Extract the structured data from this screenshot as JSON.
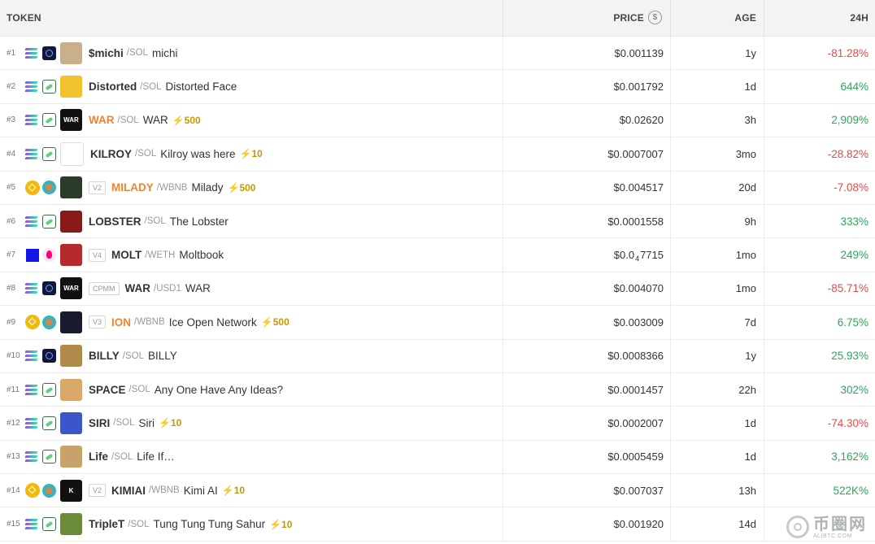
{
  "header": {
    "token": "TOKEN",
    "price": "PRICE",
    "price_icon": "dollar-circle-icon",
    "age": "AGE",
    "change": "24H"
  },
  "colors": {
    "positive": "#2ea55b",
    "negative": "#e04b4b",
    "hot_symbol": "#f0842c",
    "boost": "#c79700"
  },
  "rows": [
    {
      "rank": "#1",
      "chain": "sol",
      "dex": "launch",
      "avatar_color": "#c8b08a",
      "avatar_text": "",
      "version": "",
      "symbol": "$michi",
      "hot": false,
      "quote": "/SOL",
      "name": "michi",
      "boost": "",
      "price": "$0.001139",
      "price_main": "",
      "price_sub": "",
      "price_tail": "",
      "age": "1y",
      "change": "-81.28%",
      "change_sign": "neg"
    },
    {
      "rank": "#2",
      "chain": "sol",
      "dex": "pump",
      "avatar_color": "#f2c12e",
      "avatar_text": "",
      "version": "",
      "symbol": "Distorted",
      "hot": false,
      "quote": "/SOL",
      "name": "Distorted Face",
      "boost": "",
      "price": "$0.001792",
      "price_main": "",
      "price_sub": "",
      "price_tail": "",
      "age": "1d",
      "change": "644%",
      "change_sign": "pos"
    },
    {
      "rank": "#3",
      "chain": "sol",
      "dex": "pump",
      "avatar_color": "#111111",
      "avatar_text": "WAR",
      "version": "",
      "symbol": "WAR",
      "hot": true,
      "quote": "/SOL",
      "name": "WAR",
      "boost": "500",
      "price": "$0.02620",
      "price_main": "",
      "price_sub": "",
      "price_tail": "",
      "age": "3h",
      "change": "2,909%",
      "change_sign": "pos"
    },
    {
      "rank": "#4",
      "chain": "sol",
      "dex": "pump",
      "avatar_color": "#ffffff",
      "avatar_text": "",
      "version": "",
      "symbol": "KILROY",
      "hot": false,
      "quote": "/SOL",
      "name": "Kilroy was here",
      "boost": "10",
      "price": "$0.0007007",
      "price_main": "",
      "price_sub": "",
      "price_tail": "",
      "age": "3mo",
      "change": "-28.82%",
      "change_sign": "neg"
    },
    {
      "rank": "#5",
      "chain": "bsc",
      "dex": "cake",
      "avatar_color": "#2a3b2a",
      "avatar_text": "",
      "version": "V2",
      "symbol": "MILADY",
      "hot": true,
      "quote": "/WBNB",
      "name": "Milady",
      "boost": "500",
      "price": "$0.004517",
      "price_main": "",
      "price_sub": "",
      "price_tail": "",
      "age": "20d",
      "change": "-7.08%",
      "change_sign": "neg"
    },
    {
      "rank": "#6",
      "chain": "sol",
      "dex": "pump",
      "avatar_color": "#8a1a1a",
      "avatar_text": "",
      "version": "",
      "symbol": "LOBSTER",
      "hot": false,
      "quote": "/SOL",
      "name": "The Lobster",
      "boost": "",
      "price": "$0.0001558",
      "price_main": "",
      "price_sub": "",
      "price_tail": "",
      "age": "9h",
      "change": "333%",
      "change_sign": "pos"
    },
    {
      "rank": "#7",
      "chain": "eth",
      "dex": "uni",
      "avatar_color": "#b52a2a",
      "avatar_text": "",
      "version": "V4",
      "symbol": "MOLT",
      "hot": false,
      "quote": "/WETH",
      "name": "Moltbook",
      "boost": "",
      "price": "",
      "price_main": "$0.0",
      "price_sub": "4",
      "price_tail": "7715",
      "age": "1mo",
      "change": "249%",
      "change_sign": "pos"
    },
    {
      "rank": "#8",
      "chain": "sol",
      "dex": "launch",
      "avatar_color": "#111111",
      "avatar_text": "WAR",
      "version": "CPMM",
      "symbol": "WAR",
      "hot": false,
      "quote": "/USD1",
      "name": "WAR",
      "boost": "",
      "price": "$0.004070",
      "price_main": "",
      "price_sub": "",
      "price_tail": "",
      "age": "1mo",
      "change": "-85.71%",
      "change_sign": "neg"
    },
    {
      "rank": "#9",
      "chain": "bsc",
      "dex": "cake",
      "avatar_color": "#1a1a2e",
      "avatar_text": "",
      "version": "V3",
      "symbol": "ION",
      "hot": true,
      "quote": "/WBNB",
      "name": "Ice Open Network",
      "boost": "500",
      "price": "$0.003009",
      "price_main": "",
      "price_sub": "",
      "price_tail": "",
      "age": "7d",
      "change": "6.75%",
      "change_sign": "pos"
    },
    {
      "rank": "#10",
      "chain": "sol",
      "dex": "launch",
      "avatar_color": "#b08a4a",
      "avatar_text": "",
      "version": "",
      "symbol": "BILLY",
      "hot": false,
      "quote": "/SOL",
      "name": "BILLY",
      "boost": "",
      "price": "$0.0008366",
      "price_main": "",
      "price_sub": "",
      "price_tail": "",
      "age": "1y",
      "change": "25.93%",
      "change_sign": "pos"
    },
    {
      "rank": "#11",
      "chain": "sol",
      "dex": "pump",
      "avatar_color": "#d9a86a",
      "avatar_text": "",
      "version": "",
      "symbol": "SPACE",
      "hot": false,
      "quote": "/SOL",
      "name": "Any One Have Any Ideas?",
      "boost": "",
      "price": "$0.0001457",
      "price_main": "",
      "price_sub": "",
      "price_tail": "",
      "age": "22h",
      "change": "302%",
      "change_sign": "pos"
    },
    {
      "rank": "#12",
      "chain": "sol",
      "dex": "pump",
      "avatar_color": "#3a56c8",
      "avatar_text": "",
      "version": "",
      "symbol": "SIRI",
      "hot": false,
      "quote": "/SOL",
      "name": "Siri",
      "boost": "10",
      "price": "$0.0002007",
      "price_main": "",
      "price_sub": "",
      "price_tail": "",
      "age": "1d",
      "change": "-74.30%",
      "change_sign": "neg"
    },
    {
      "rank": "#13",
      "chain": "sol",
      "dex": "pump",
      "avatar_color": "#c9a26b",
      "avatar_text": "",
      "version": "",
      "symbol": "Life",
      "hot": false,
      "quote": "/SOL",
      "name": "Life If…",
      "boost": "",
      "price": "$0.0005459",
      "price_main": "",
      "price_sub": "",
      "price_tail": "",
      "age": "1d",
      "change": "3,162%",
      "change_sign": "pos"
    },
    {
      "rank": "#14",
      "chain": "bsc",
      "dex": "cake",
      "avatar_color": "#111111",
      "avatar_text": "K",
      "version": "V2",
      "symbol": "KIMIAI",
      "hot": false,
      "quote": "/WBNB",
      "name": "Kimi AI",
      "boost": "10",
      "price": "$0.007037",
      "price_main": "",
      "price_sub": "",
      "price_tail": "",
      "age": "13h",
      "change": "522K%",
      "change_sign": "pos"
    },
    {
      "rank": "#15",
      "chain": "sol",
      "dex": "pump",
      "avatar_color": "#6b8a3a",
      "avatar_text": "",
      "version": "",
      "symbol": "TripleT",
      "hot": false,
      "quote": "/SOL",
      "name": "Tung Tung Tung Sahur",
      "boost": "10",
      "price": "$0.001920",
      "price_main": "",
      "price_sub": "",
      "price_tail": "",
      "age": "14d",
      "change": "",
      "change_sign": "neg"
    }
  ],
  "watermark": {
    "title": "币圈网",
    "url": "ALIBTC.COM"
  }
}
